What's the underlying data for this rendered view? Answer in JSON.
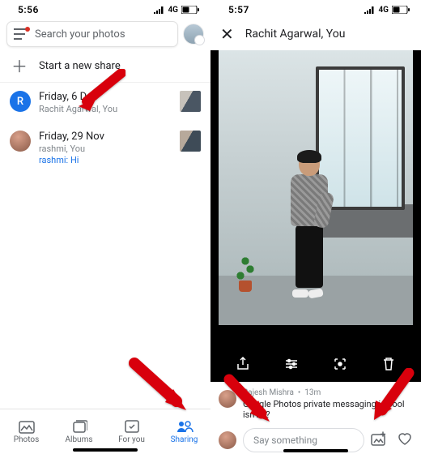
{
  "left": {
    "status": {
      "time": "5:56",
      "network": "4G"
    },
    "search_placeholder": "Search your photos",
    "new_share_label": "Start a new share",
    "conversations": [
      {
        "avatar_letter": "R",
        "title": "Friday, 6 Dec",
        "subtitle": "Rachit Agarwal, You"
      },
      {
        "title": "Friday, 29 Nov",
        "subtitle": "rashmi, You",
        "message_prefix": "rashmi:",
        "message_text": "Hi"
      }
    ],
    "tabs": {
      "photos": "Photos",
      "albums": "Albums",
      "for_you": "For you",
      "sharing": "Sharing"
    }
  },
  "right": {
    "status": {
      "time": "5:57",
      "network": "4G"
    },
    "title": "Rachit Agarwal, You",
    "comment": {
      "author": "Rajesh Mishra",
      "time_ago": "13m",
      "text": "Google Photos private messaging is cool isn't it?"
    },
    "input_placeholder": "Say something"
  }
}
